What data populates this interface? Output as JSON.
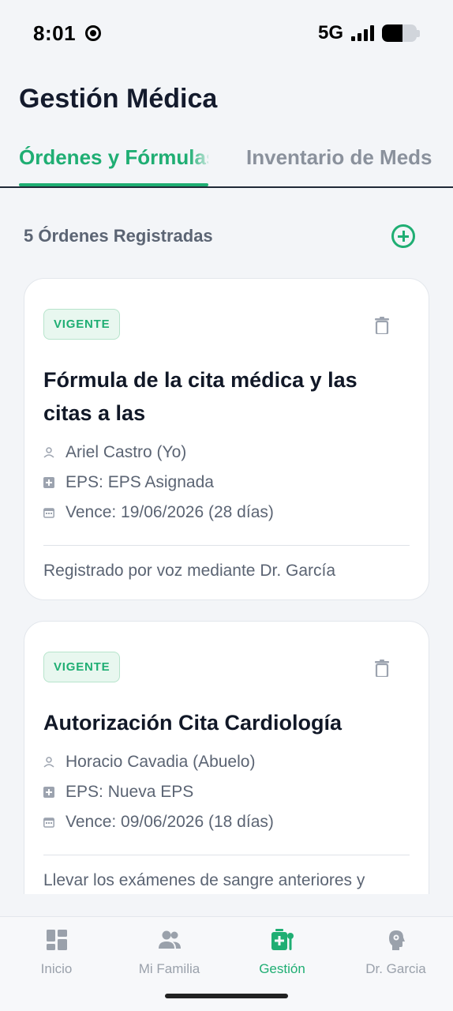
{
  "status_bar": {
    "time": "8:01",
    "network": "5G",
    "battery_level": 0.6
  },
  "header": {
    "title": "Gestión Médica"
  },
  "tabs": [
    {
      "label": "Órdenes y Fórmulas",
      "active": true
    },
    {
      "label": "Inventario de Meds",
      "active": false
    }
  ],
  "list": {
    "count_label": "5 Órdenes Registradas"
  },
  "cards": [
    {
      "badge": "VIGENTE",
      "title": "Fórmula de la cita médica y las citas a las",
      "patient": "Ariel Castro (Yo)",
      "eps": "EPS: EPS Asignada",
      "expires": "Vence: 19/06/2026 (28 días)",
      "note": "Registrado por voz mediante Dr. García"
    },
    {
      "badge": "VIGENTE",
      "title": "Autorización Cita Cardiología",
      "patient": "Horacio Cavadia (Abuelo)",
      "eps": "EPS: Nueva EPS",
      "expires": "Vence: 09/06/2026 (18 días)",
      "note": "Llevar los exámenes de sangre anteriores y"
    }
  ],
  "nav": [
    {
      "label": "Inicio",
      "icon": "dashboard-icon",
      "active": false
    },
    {
      "label": "Mi Familia",
      "icon": "family-icon",
      "active": false
    },
    {
      "label": "Gestión",
      "icon": "medical-kit-icon",
      "active": true
    },
    {
      "label": "Dr. Garcia",
      "icon": "doctor-assistant-icon",
      "active": false
    }
  ],
  "colors": {
    "accent": "#1fae73",
    "text_primary": "#111827",
    "text_secondary": "#5b6473",
    "background": "#f3f5f8"
  }
}
